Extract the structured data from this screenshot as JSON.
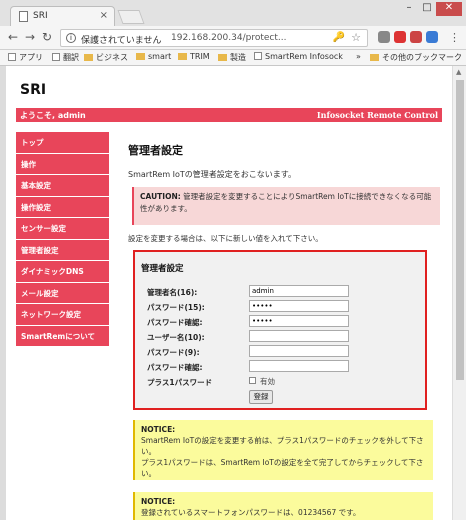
{
  "browser": {
    "tab_title": "SRI",
    "close_glyph": "×",
    "security_label": "保護されていません",
    "url": "192.168.200.34/protect...",
    "bookmarks": [
      "アプリ",
      "翻訳",
      "ビジネス",
      "smart",
      "TRIM",
      "製造",
      "SmartRem Infosock"
    ],
    "bookmarks_more": "»",
    "other_bookmarks": "その他のブックマーク"
  },
  "page": {
    "brand": "SRI",
    "welcome": "ようこそ, admin",
    "product": "Infosocket Remote Control",
    "sidebar": [
      "トップ",
      "操作",
      "基本設定",
      "操作設定",
      "センサー設定",
      "管理者設定",
      "ダイナミックDNS",
      "メール設定",
      "ネットワーク設定",
      "SmartRemについて"
    ],
    "title": "管理者設定",
    "description": "SmartRem IoTの管理者設定をおこないます。",
    "caution_label": "CAUTION:",
    "caution_text": "管理者設定を変更することによりSmartRem IoTに接続できなくなる可能性があります。",
    "instruction": "設定を変更する場合は、以下に新しい値を入れて下さい。",
    "form": {
      "heading": "管理者設定",
      "fields": [
        {
          "label": "管理者名(16):",
          "value": "admin"
        },
        {
          "label": "パスワード(15):",
          "value": "•••••"
        },
        {
          "label": "パスワード確認:",
          "value": "•••••"
        },
        {
          "label": "ユーザー名(10):",
          "value": ""
        },
        {
          "label": "パスワード(9):",
          "value": ""
        },
        {
          "label": "パスワード確認:",
          "value": ""
        }
      ],
      "plus1_label": "プラス1パスワード",
      "plus1_checkbox": "有効",
      "submit": "登録"
    },
    "notice1_label": "NOTICE:",
    "notice1_line1": "SmartRem IoTの設定を変更する前は、プラス1パスワードのチェックを外して下さい。",
    "notice1_line2": "プラス1パスワードは、SmartRem IoTの設定を全て完了してからチェックして下さい。",
    "notice2_label": "NOTICE:",
    "notice2_text": "登録されているスマートフォンパスワードは、01234567 です。"
  }
}
